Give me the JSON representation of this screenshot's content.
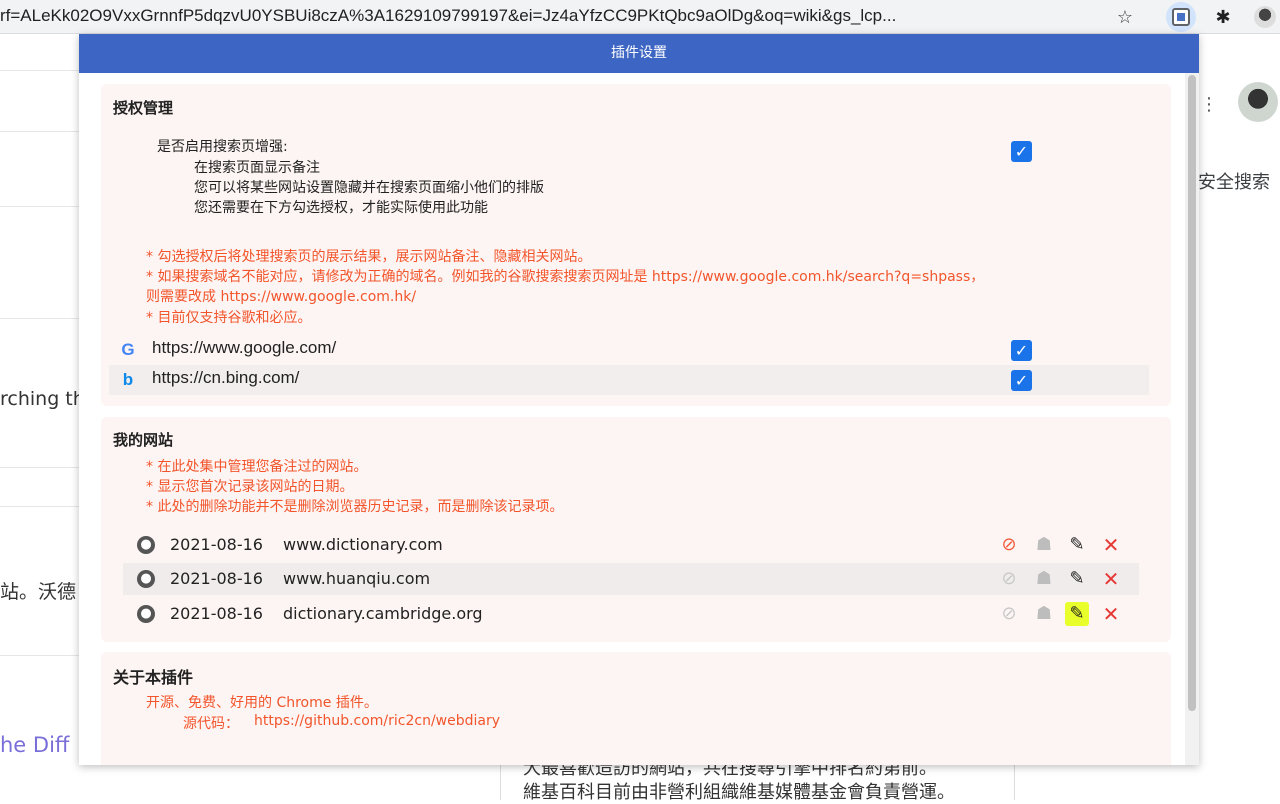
{
  "browser": {
    "url": "rf=ALeKk02O9VxxGrnnfP5dqzvU0YSBUi8czA%3A1629109799197&ei=Jz4aYfzCC9PKtQbc9aOlDg&oq=wiki&gs_lcp...",
    "star_icon": "star-icon",
    "extension_icon": "webdiary-extension-icon",
    "puzzle_icon": "extensions-puzzle-icon"
  },
  "background_page": {
    "left_fragment_1": "rching thr",
    "left_fragment_2": "站。沃德",
    "left_fragment_3": "he Diff",
    "right_fragment": "安全搜索",
    "bottom_line_1": "大最喜歡造訪的網站，共在搜尋引擎中排名約第前。",
    "bottom_line_2": "維基百科目前由非營利組織維基媒體基金會負責營運。"
  },
  "popup": {
    "title": "插件设置",
    "auth": {
      "title": "授权管理",
      "enable_label": "是否启用搜索页增强:",
      "enable_desc": [
        "在搜索页面显示备注",
        "您可以将某些网站设置隐藏并在搜索页面缩小他们的排版",
        "您还需要在下方勾选授权，才能实际使用此功能"
      ],
      "enabled": true,
      "notes": [
        "* 勾选授权后将处理搜索页的展示结果，展示网站备注、隐藏相关网站。",
        "* 如果搜索域名不能对应，请修改为正确的域名。例如我的谷歌搜索搜索页网址是 https://www.google.com.hk/search?q=shpass，",
        "则需要改成 https://www.google.com.hk/",
        "* 目前仅支持谷歌和必应。"
      ],
      "engines": [
        {
          "icon": "google-icon",
          "glyph": "G",
          "url": "https://www.google.com/",
          "checked": true,
          "color": "#4285f4"
        },
        {
          "icon": "bing-icon",
          "glyph": "b",
          "url": "https://cn.bing.com/",
          "checked": true,
          "color": "#0f8ae8"
        }
      ]
    },
    "my_sites": {
      "title": "我的网站",
      "notes": [
        "* 在此处集中管理您备注过的网站。",
        "* 显示您首次记录该网站的日期。",
        "* 此处的删除功能并不是删除浏览器历史记录，而是删除该记录项。"
      ],
      "rows": [
        {
          "date": "2021-08-16",
          "domain": "www.dictionary.com",
          "hidden": true,
          "edit_highlight": false
        },
        {
          "date": "2021-08-16",
          "domain": "www.huanqiu.com",
          "hidden": false,
          "edit_highlight": false
        },
        {
          "date": "2021-08-16",
          "domain": "dictionary.cambridge.org",
          "hidden": false,
          "edit_highlight": true
        }
      ]
    },
    "about": {
      "title": "关于本插件",
      "line1": "开源、免费、好用的 Chrome 插件。",
      "source_label": "源代码：",
      "source_url": "https://github.com/ric2cn/webdiary"
    }
  }
}
